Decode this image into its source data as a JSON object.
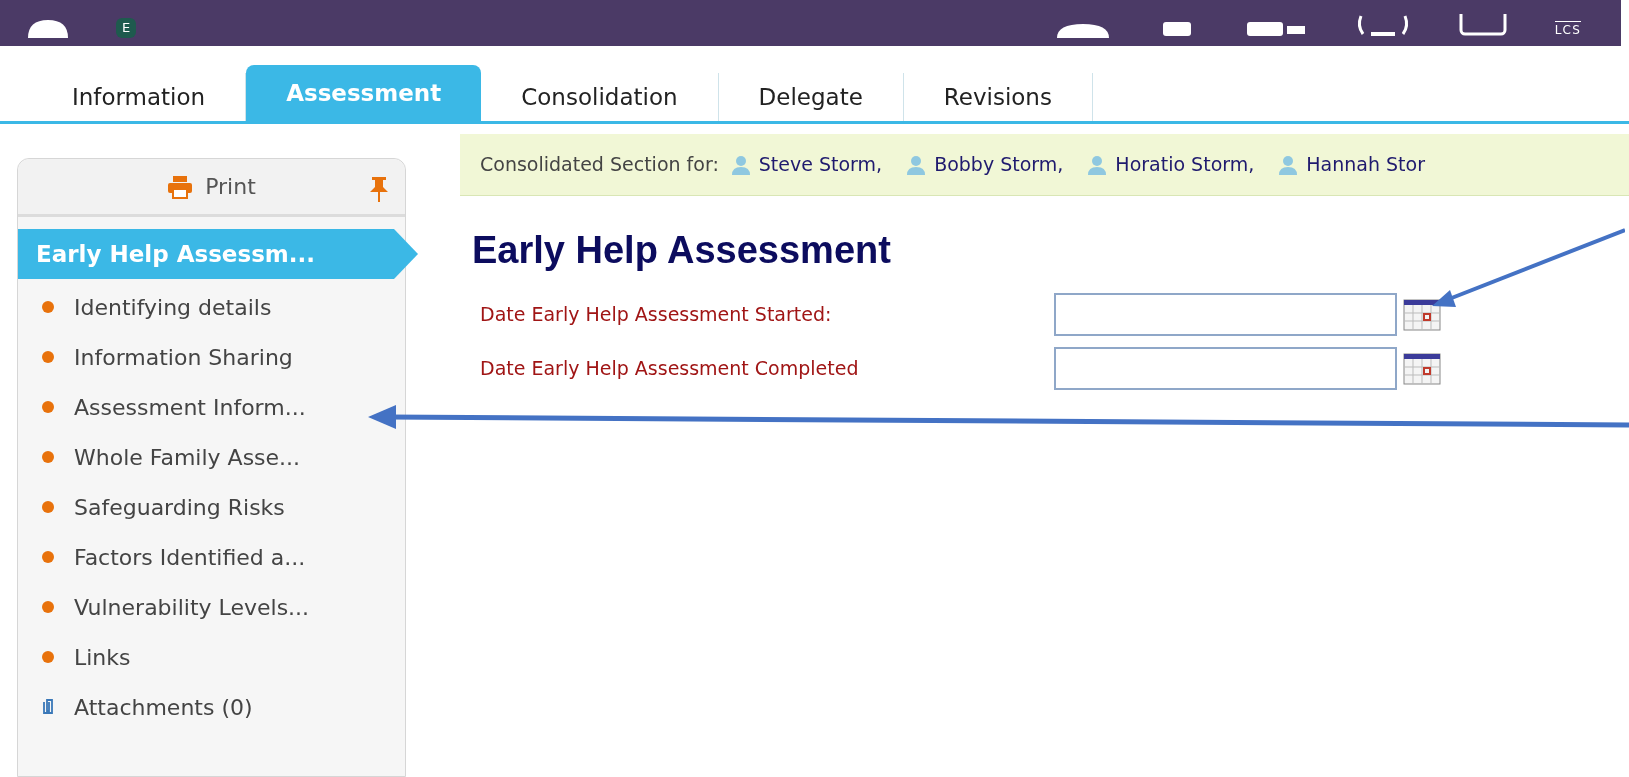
{
  "header": {
    "badge": "E",
    "user_code": "LCS"
  },
  "tabs": [
    {
      "label": "Information",
      "selected": false
    },
    {
      "label": "Assessment",
      "selected": true
    },
    {
      "label": "Consolidation",
      "selected": false
    },
    {
      "label": "Delegate",
      "selected": false
    },
    {
      "label": "Revisions",
      "selected": false
    }
  ],
  "sidebar": {
    "print_label": "Print",
    "title": "Early Help Assessm...",
    "items": [
      {
        "label": "Identifying details",
        "kind": "section"
      },
      {
        "label": "Information Sharing",
        "kind": "section"
      },
      {
        "label": "Assessment Inform...",
        "kind": "section"
      },
      {
        "label": "Whole Family Asse...",
        "kind": "section"
      },
      {
        "label": "Safeguarding Risks",
        "kind": "section"
      },
      {
        "label": "Factors Identified a...",
        "kind": "section"
      },
      {
        "label": "Vulnerability Levels...",
        "kind": "section"
      },
      {
        "label": "Links",
        "kind": "section"
      },
      {
        "label": "Attachments (0)",
        "kind": "attachments"
      }
    ]
  },
  "consolidated": {
    "label": "Consolidated Section for:",
    "people": [
      "Steve Storm,",
      "Bobby Storm,",
      "Horatio Storm,",
      "Hannah Stor"
    ]
  },
  "form": {
    "title": "Early Help Assessment",
    "fields": [
      {
        "label": "Date Early Help Assessment Started:"
      },
      {
        "label": "Date Early Help Assessment Completed"
      }
    ]
  }
}
